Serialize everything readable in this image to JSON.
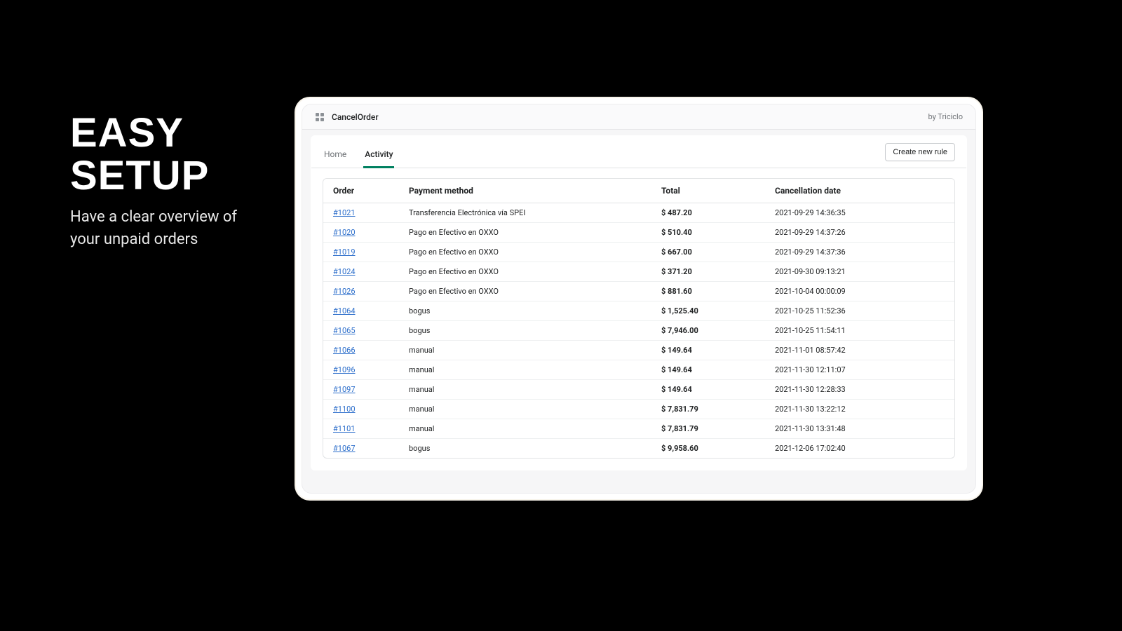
{
  "promo": {
    "headline_line1": "EASY",
    "headline_line2": "SETUP",
    "sub": "Have a clear overview of your unpaid orders"
  },
  "app": {
    "icon_name": "app-grid-icon",
    "title": "CancelOrder",
    "by_label": "by Triciclo"
  },
  "tabs": {
    "home": "Home",
    "activity": "Activity",
    "active": "activity"
  },
  "actions": {
    "create_new_rule": "Create new rule"
  },
  "table": {
    "headers": {
      "order": "Order",
      "payment_method": "Payment method",
      "total": "Total",
      "cancellation_date": "Cancellation date"
    },
    "rows": [
      {
        "order": "#1021",
        "method": "Transferencia Electrónica vía SPEI",
        "total": "$ 487.20",
        "date": "2021-09-29 14:36:35"
      },
      {
        "order": "#1020",
        "method": "Pago en Efectivo en OXXO",
        "total": "$ 510.40",
        "date": "2021-09-29 14:37:26"
      },
      {
        "order": "#1019",
        "method": "Pago en Efectivo en OXXO",
        "total": "$ 667.00",
        "date": "2021-09-29 14:37:36"
      },
      {
        "order": "#1024",
        "method": "Pago en Efectivo en OXXO",
        "total": "$ 371.20",
        "date": "2021-09-30 09:13:21"
      },
      {
        "order": "#1026",
        "method": "Pago en Efectivo en OXXO",
        "total": "$ 881.60",
        "date": "2021-10-04 00:00:09"
      },
      {
        "order": "#1064",
        "method": "bogus",
        "total": "$ 1,525.40",
        "date": "2021-10-25 11:52:36"
      },
      {
        "order": "#1065",
        "method": "bogus",
        "total": "$ 7,946.00",
        "date": "2021-10-25 11:54:11"
      },
      {
        "order": "#1066",
        "method": "manual",
        "total": "$ 149.64",
        "date": "2021-11-01 08:57:42"
      },
      {
        "order": "#1096",
        "method": "manual",
        "total": "$ 149.64",
        "date": "2021-11-30 12:11:07"
      },
      {
        "order": "#1097",
        "method": "manual",
        "total": "$ 149.64",
        "date": "2021-11-30 12:28:33"
      },
      {
        "order": "#1100",
        "method": "manual",
        "total": "$ 7,831.79",
        "date": "2021-11-30 13:22:12"
      },
      {
        "order": "#1101",
        "method": "manual",
        "total": "$ 7,831.79",
        "date": "2021-11-30 13:31:48"
      },
      {
        "order": "#1067",
        "method": "bogus",
        "total": "$ 9,958.60",
        "date": "2021-12-06 17:02:40"
      }
    ]
  }
}
